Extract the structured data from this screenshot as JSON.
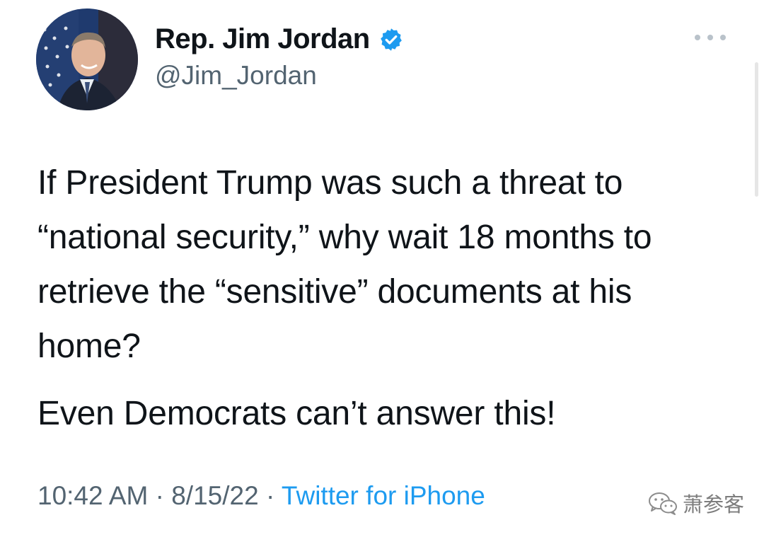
{
  "author": {
    "display_name": "Rep. Jim Jordan",
    "handle": "@Jim_Jordan",
    "verified": true,
    "verified_color": "#1d9bf0"
  },
  "tweet": {
    "paragraphs": [
      "If President Trump was such a threat to “national security,” why wait 18 months to retrieve the “sensitive” documents at his home?",
      "Even Democrats can’t answer this!"
    ]
  },
  "meta": {
    "time": "10:42 AM",
    "separator": "·",
    "date": "8/15/22",
    "source": "Twitter for iPhone",
    "source_color": "#1d9bf0"
  },
  "watermark": {
    "text": "萧参客",
    "icon": "wechat-icon"
  },
  "icons": {
    "more": "more-horizontal-icon",
    "verified": "verified-badge-icon"
  }
}
